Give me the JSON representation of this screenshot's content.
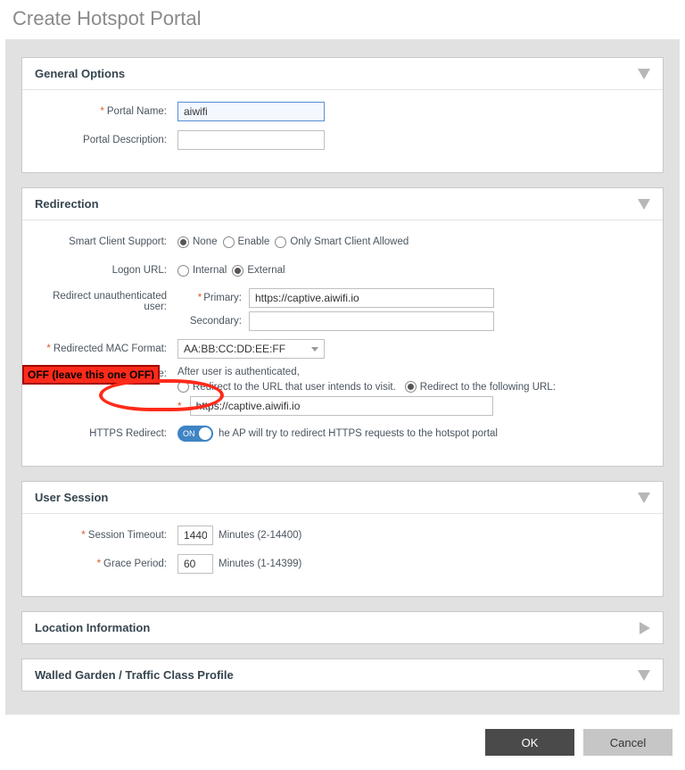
{
  "title": "Create Hotspot Portal",
  "sections": {
    "general": {
      "title": "General Options",
      "portal_name_label": "Portal Name:",
      "portal_name_value": "aiwifi",
      "portal_desc_label": "Portal Description:",
      "portal_desc_value": ""
    },
    "redirection": {
      "title": "Redirection",
      "smart_client_label": "Smart Client Support:",
      "smart_client_options": {
        "none": "None",
        "enable": "Enable",
        "only": "Only Smart Client Allowed"
      },
      "logon_url_label": "Logon URL:",
      "logon_url_options": {
        "internal": "Internal",
        "external": "External"
      },
      "redirect_unauth_label": "Redirect unauthenticated user:",
      "primary_label": "Primary:",
      "primary_value": "https://captive.aiwifi.io",
      "secondary_label": "Secondary:",
      "secondary_value": "",
      "mac_format_label": "Redirected MAC Format:",
      "mac_format_value": "AA:BB:CC:DD:EE:FF",
      "start_page_label": "Start Page:",
      "start_page_note": "After user is authenticated,",
      "start_page_opt_visit": "Redirect to the URL that user intends to visit.",
      "start_page_opt_following": "Redirect to the following URL:",
      "start_page_url_value": "https://captive.aiwifi.io",
      "https_redirect_label": "HTTPS Redirect:",
      "https_redirect_toggle": "ON",
      "https_redirect_note": "he AP will try to redirect HTTPS requests to the hotspot portal",
      "callout_off": "OFF (leave this one OFF)"
    },
    "user_session": {
      "title": "User Session",
      "session_timeout_label": "Session Timeout:",
      "session_timeout_value": "1440",
      "session_timeout_units": "Minutes (2-14400)",
      "grace_period_label": "Grace Period:",
      "grace_period_value": "60",
      "grace_period_units": "Minutes (1-14399)"
    },
    "location": {
      "title": "Location Information"
    },
    "walled_garden": {
      "title": "Walled Garden / Traffic Class Profile"
    }
  },
  "buttons": {
    "ok": "OK",
    "cancel": "Cancel"
  }
}
